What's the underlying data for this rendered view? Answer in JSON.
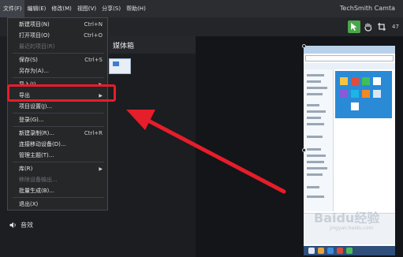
{
  "app": {
    "title": "TechSmith Camta",
    "zoom": "47"
  },
  "menubar": [
    {
      "label": "文件(F)",
      "active": true
    },
    {
      "label": "编辑(E)",
      "active": false
    },
    {
      "label": "修改(M)",
      "active": false
    },
    {
      "label": "视图(V)",
      "active": false
    },
    {
      "label": "分享(S)",
      "active": false
    },
    {
      "label": "帮助(H)",
      "active": false
    }
  ],
  "media_bin": {
    "title": "媒体箱"
  },
  "audio": {
    "label": "音效"
  },
  "file_menu": [
    {
      "label": "新建项目(N)",
      "shortcut": "Ctrl+N",
      "submenu": false,
      "disabled": false
    },
    {
      "label": "打开项目(O)",
      "shortcut": "Ctrl+O",
      "submenu": false,
      "disabled": false
    },
    {
      "label": "最近的项目(R)",
      "shortcut": "",
      "submenu": false,
      "disabled": true
    },
    {
      "label": "保存(S)",
      "shortcut": "Ctrl+S",
      "submenu": false,
      "disabled": false
    },
    {
      "label": "另存为(A)...",
      "shortcut": "",
      "submenu": false,
      "disabled": false
    },
    {
      "label": "导入(I)",
      "shortcut": "",
      "submenu": true,
      "disabled": false
    },
    {
      "label": "导出",
      "shortcut": "",
      "submenu": true,
      "disabled": false
    },
    {
      "label": "项目设置(J)...",
      "shortcut": "",
      "submenu": false,
      "disabled": false
    },
    {
      "label": "登录(G)...",
      "shortcut": "",
      "submenu": false,
      "disabled": false
    },
    {
      "label": "新建录制(R)...",
      "shortcut": "Ctrl+R",
      "submenu": false,
      "disabled": false
    },
    {
      "label": "连接移动设备(D)...",
      "shortcut": "",
      "submenu": false,
      "disabled": false
    },
    {
      "label": "管理主题(T)...",
      "shortcut": "",
      "submenu": false,
      "disabled": false
    },
    {
      "label": "库(R)",
      "shortcut": "",
      "submenu": true,
      "disabled": false
    },
    {
      "label": "移除设备输出...",
      "shortcut": "",
      "submenu": false,
      "disabled": true
    },
    {
      "label": "批量生成(B)...",
      "shortcut": "",
      "submenu": false,
      "disabled": false
    },
    {
      "label": "退出(X)",
      "shortcut": "",
      "submenu": false,
      "disabled": false
    }
  ],
  "watermark": {
    "text": "Baidu经验",
    "sub": "jingyan.baidu.com"
  },
  "colors": {
    "highlight": "#e61d2a",
    "arrow": "#e61d2a",
    "select_tool": "#4aa64a"
  }
}
